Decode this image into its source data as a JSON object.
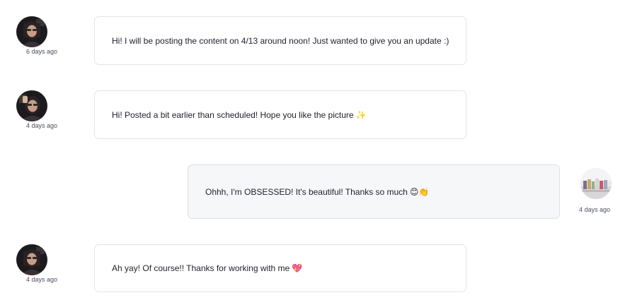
{
  "messages": [
    {
      "direction": "incoming",
      "text": "Hi! I will be posting the content on 4/13 around noon! Just wanted to give you an update :)",
      "emoji": "",
      "time": "6 days ago"
    },
    {
      "direction": "incoming",
      "text": "Hi! Posted a bit earlier than scheduled! Hope you like the picture",
      "emoji": "✨",
      "time": "4 days ago"
    },
    {
      "direction": "outgoing",
      "text": "Ohhh, I'm OBSESSED! It's beautiful! Thanks so much",
      "emoji": "😊👏",
      "time": "4 days ago"
    },
    {
      "direction": "incoming",
      "text": "Ah yay! Of course!! Thanks for working with me",
      "emoji": "💖",
      "time": "4 days ago"
    }
  ],
  "colors": {
    "bubble_border": "#e3e5ea",
    "outgoing_bubble_bg": "#f6f7f9",
    "timestamp_text": "#4a4f5c"
  }
}
